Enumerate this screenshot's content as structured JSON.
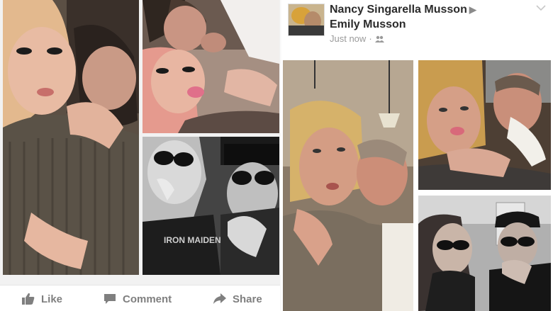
{
  "post": {
    "author": "Nancy Singarella Musson",
    "tagged": "Emily Musson",
    "timestamp": "Just now",
    "audience_icon": "friends-icon"
  },
  "actions": {
    "like_label": "Like",
    "comment_label": "Comment",
    "share_label": "Share"
  },
  "colors": {
    "action_gray": "#7f7f7f",
    "name_text": "#2b2b2b",
    "meta_text": "#9a9a9a"
  }
}
